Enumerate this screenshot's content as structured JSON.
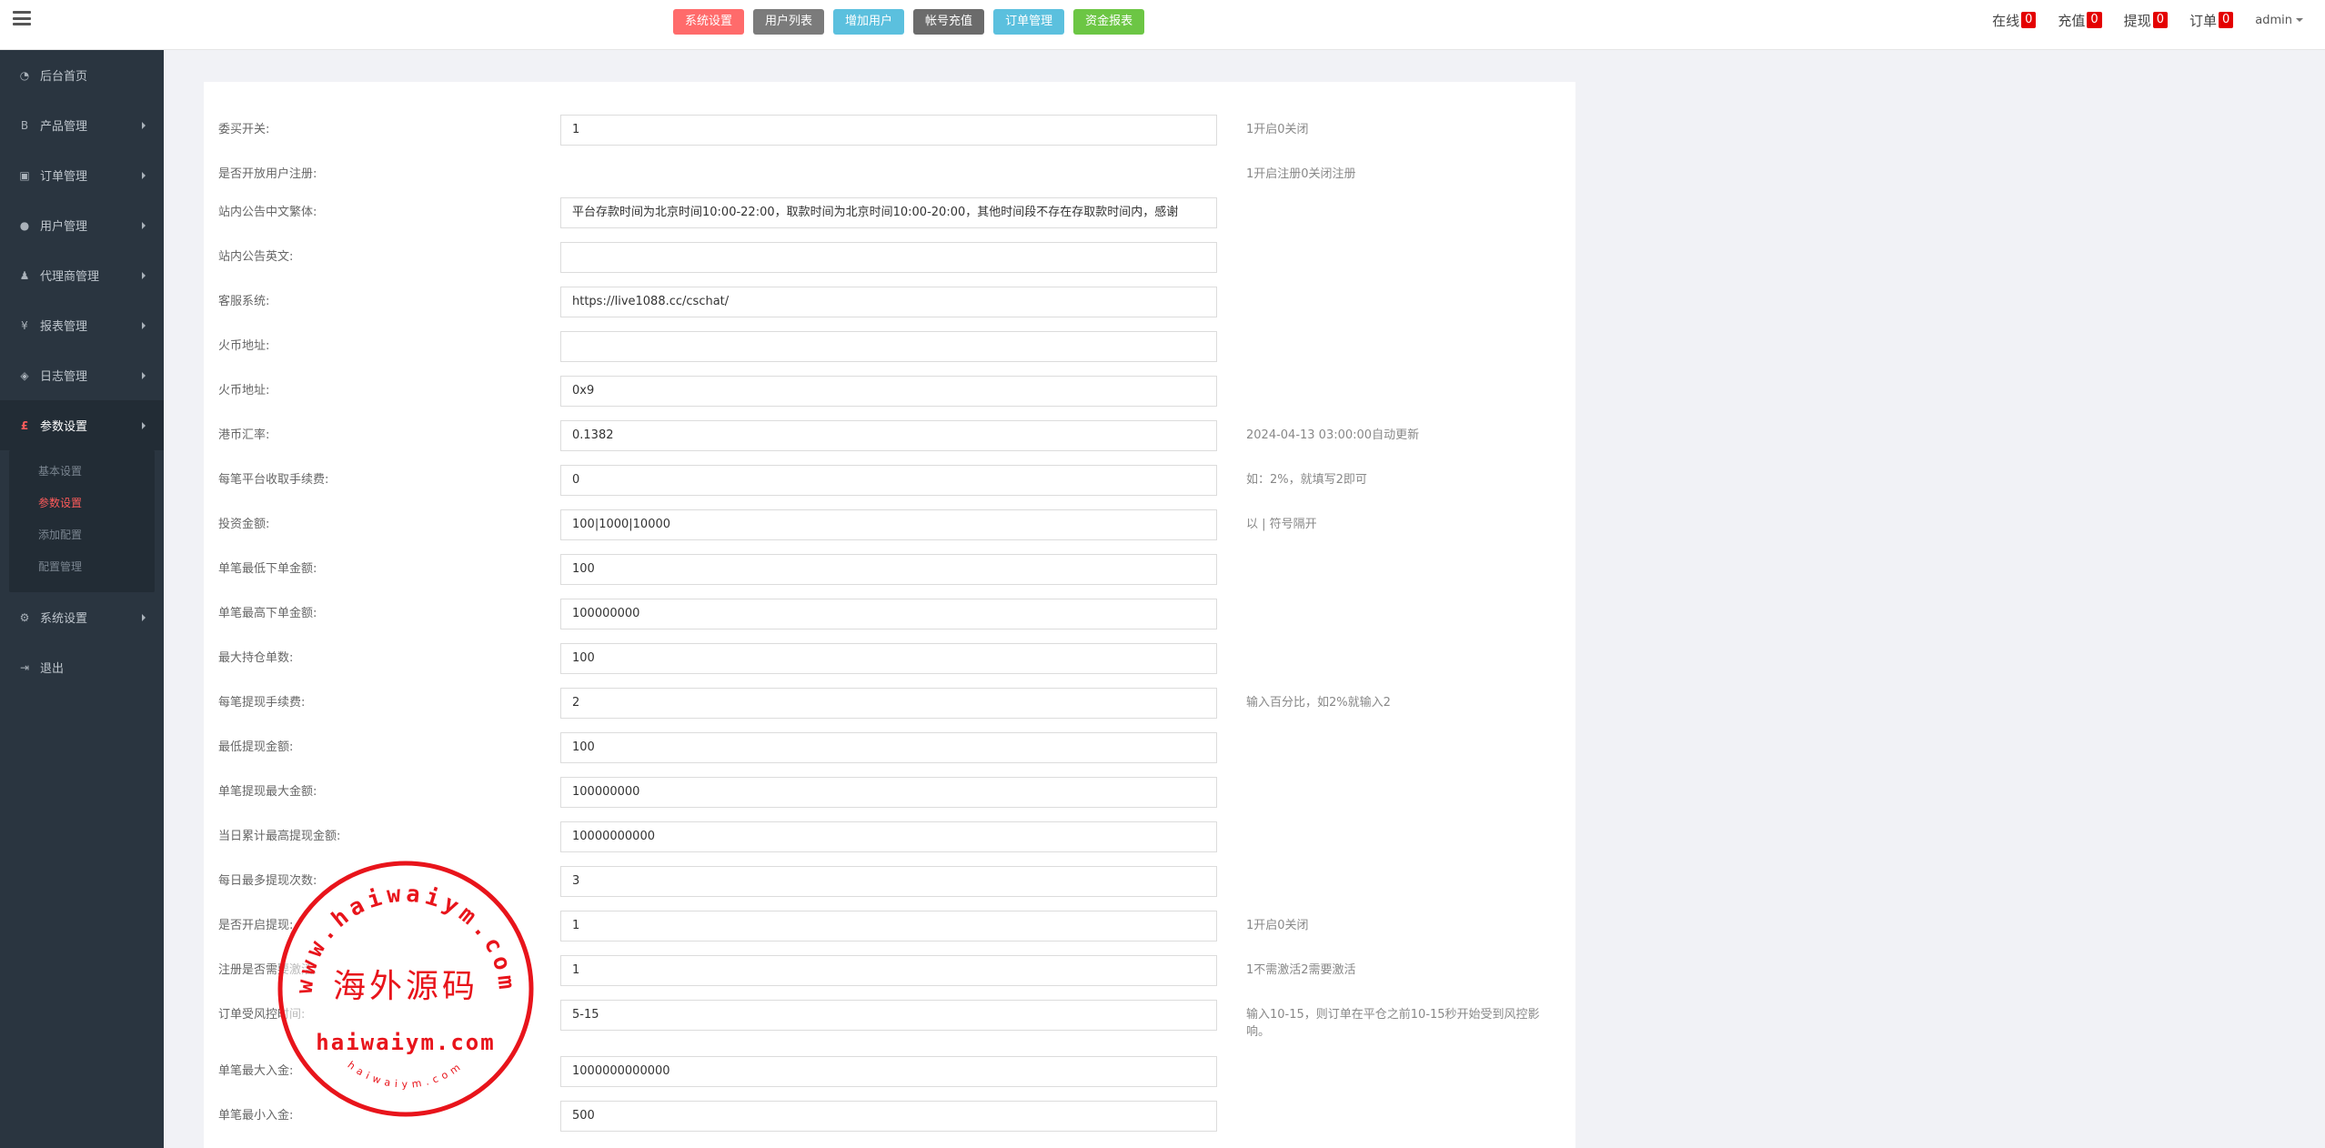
{
  "topbar": {
    "buttons": [
      {
        "label": "系统设置",
        "color": "#ff6b6b"
      },
      {
        "label": "用户列表",
        "color": "#7b7b7b"
      },
      {
        "label": "增加用户",
        "color": "#5bc0de"
      },
      {
        "label": "帐号充值",
        "color": "#6b6b6b"
      },
      {
        "label": "订单管理",
        "color": "#5bc0de"
      },
      {
        "label": "资金报表",
        "color": "#6cc644"
      }
    ],
    "stats": [
      {
        "label": "在线",
        "count": "0"
      },
      {
        "label": "充值",
        "count": "0"
      },
      {
        "label": "提现",
        "count": "0"
      },
      {
        "label": "订单",
        "count": "0"
      }
    ],
    "user": "admin"
  },
  "sidebar": {
    "items": [
      {
        "label": "后台首页",
        "icon": "dashboard-icon",
        "glyph": "◔"
      },
      {
        "label": "产品管理",
        "icon": "bitcoin-icon",
        "glyph": "B"
      },
      {
        "label": "订单管理",
        "icon": "copy-icon",
        "glyph": "▣"
      },
      {
        "label": "用户管理",
        "icon": "user-icon",
        "glyph": "●"
      },
      {
        "label": "代理商管理",
        "icon": "user-tie-icon",
        "glyph": "♟"
      },
      {
        "label": "报表管理",
        "icon": "yen-icon",
        "glyph": "¥"
      },
      {
        "label": "日志管理",
        "icon": "tag-icon",
        "glyph": "◈"
      },
      {
        "label": "参数设置",
        "icon": "pound-icon",
        "glyph": "£"
      },
      {
        "label": "系统设置",
        "icon": "cogs-icon",
        "glyph": "⚙"
      },
      {
        "label": "退出",
        "icon": "sign-out-icon",
        "glyph": "⇥"
      }
    ],
    "submenu": [
      "基本设置",
      "参数设置",
      "添加配置",
      "配置管理"
    ]
  },
  "form": {
    "rows": [
      {
        "label": "委买开关:",
        "value": "1",
        "hint": "1开启0关闭",
        "input": true
      },
      {
        "label": "是否开放用户注册:",
        "value": "",
        "hint": "1开启注册0关闭注册",
        "input": false
      },
      {
        "label": "站内公告中文繁体:",
        "value": "平台存款时间为北京时间10:00-22:00，取款时间为北京时间10:00-20:00，其他时间段不存在存取款时间内，感谢",
        "hint": "",
        "input": true
      },
      {
        "label": "站内公告英文:",
        "value": "",
        "hint": "",
        "input": true
      },
      {
        "label": "客服系统:",
        "value": "https://live1088.cc/cschat/",
        "hint": "",
        "input": true
      },
      {
        "label": "火币地址:",
        "value": "",
        "hint": "",
        "input": true
      },
      {
        "label": "火币地址:",
        "value": "0x9",
        "hint": "",
        "input": true
      },
      {
        "label": "港币汇率:",
        "value": "0.1382",
        "hint": "2024-04-13 03:00:00自动更新",
        "input": true
      },
      {
        "label": "每笔平台收取手续费:",
        "value": "0",
        "hint": "如：2%，就填写2即可",
        "input": true
      },
      {
        "label": "投资金额:",
        "value": "100|1000|10000",
        "hint": "以 | 符号隔开",
        "input": true
      },
      {
        "label": "单笔最低下单金额:",
        "value": "100",
        "hint": "",
        "input": true
      },
      {
        "label": "单笔最高下单金额:",
        "value": "100000000",
        "hint": "",
        "input": true
      },
      {
        "label": "最大持仓单数:",
        "value": "100",
        "hint": "",
        "input": true
      },
      {
        "label": "每笔提现手续费:",
        "value": "2",
        "hint": "输入百分比，如2%就输入2",
        "input": true
      },
      {
        "label": "最低提现金额:",
        "value": "100",
        "hint": "",
        "input": true
      },
      {
        "label": "单笔提现最大金额:",
        "value": "100000000",
        "hint": "",
        "input": true
      },
      {
        "label": "当日累计最高提现金额:",
        "value": "10000000000",
        "hint": "",
        "input": true
      },
      {
        "label": "每日最多提现次数:",
        "value": "3",
        "hint": "",
        "input": true
      },
      {
        "label": "是否开启提现:",
        "value": "1",
        "hint": "1开启0关闭",
        "input": true
      },
      {
        "label": "注册是否需要激活:",
        "value": "1",
        "hint": "1不需激活2需要激活",
        "input": true
      },
      {
        "label": "订单受风控时间:",
        "value": "5-15",
        "hint": "输入10-15，则订单在平仓之前10-15秒开始受到风控影响。",
        "input": true
      },
      {
        "label": "单笔最大入金:",
        "value": "1000000000000",
        "hint": "",
        "input": true
      },
      {
        "label": "单笔最小入金:",
        "value": "500",
        "hint": "",
        "input": true
      }
    ]
  },
  "watermark": {
    "top_text": "www.haiwaiym.com",
    "center_text": "海外源码",
    "bottom_text": "haiwaiym.com",
    "small_text": "haiwaiym.com",
    "color": "#e8141b"
  }
}
